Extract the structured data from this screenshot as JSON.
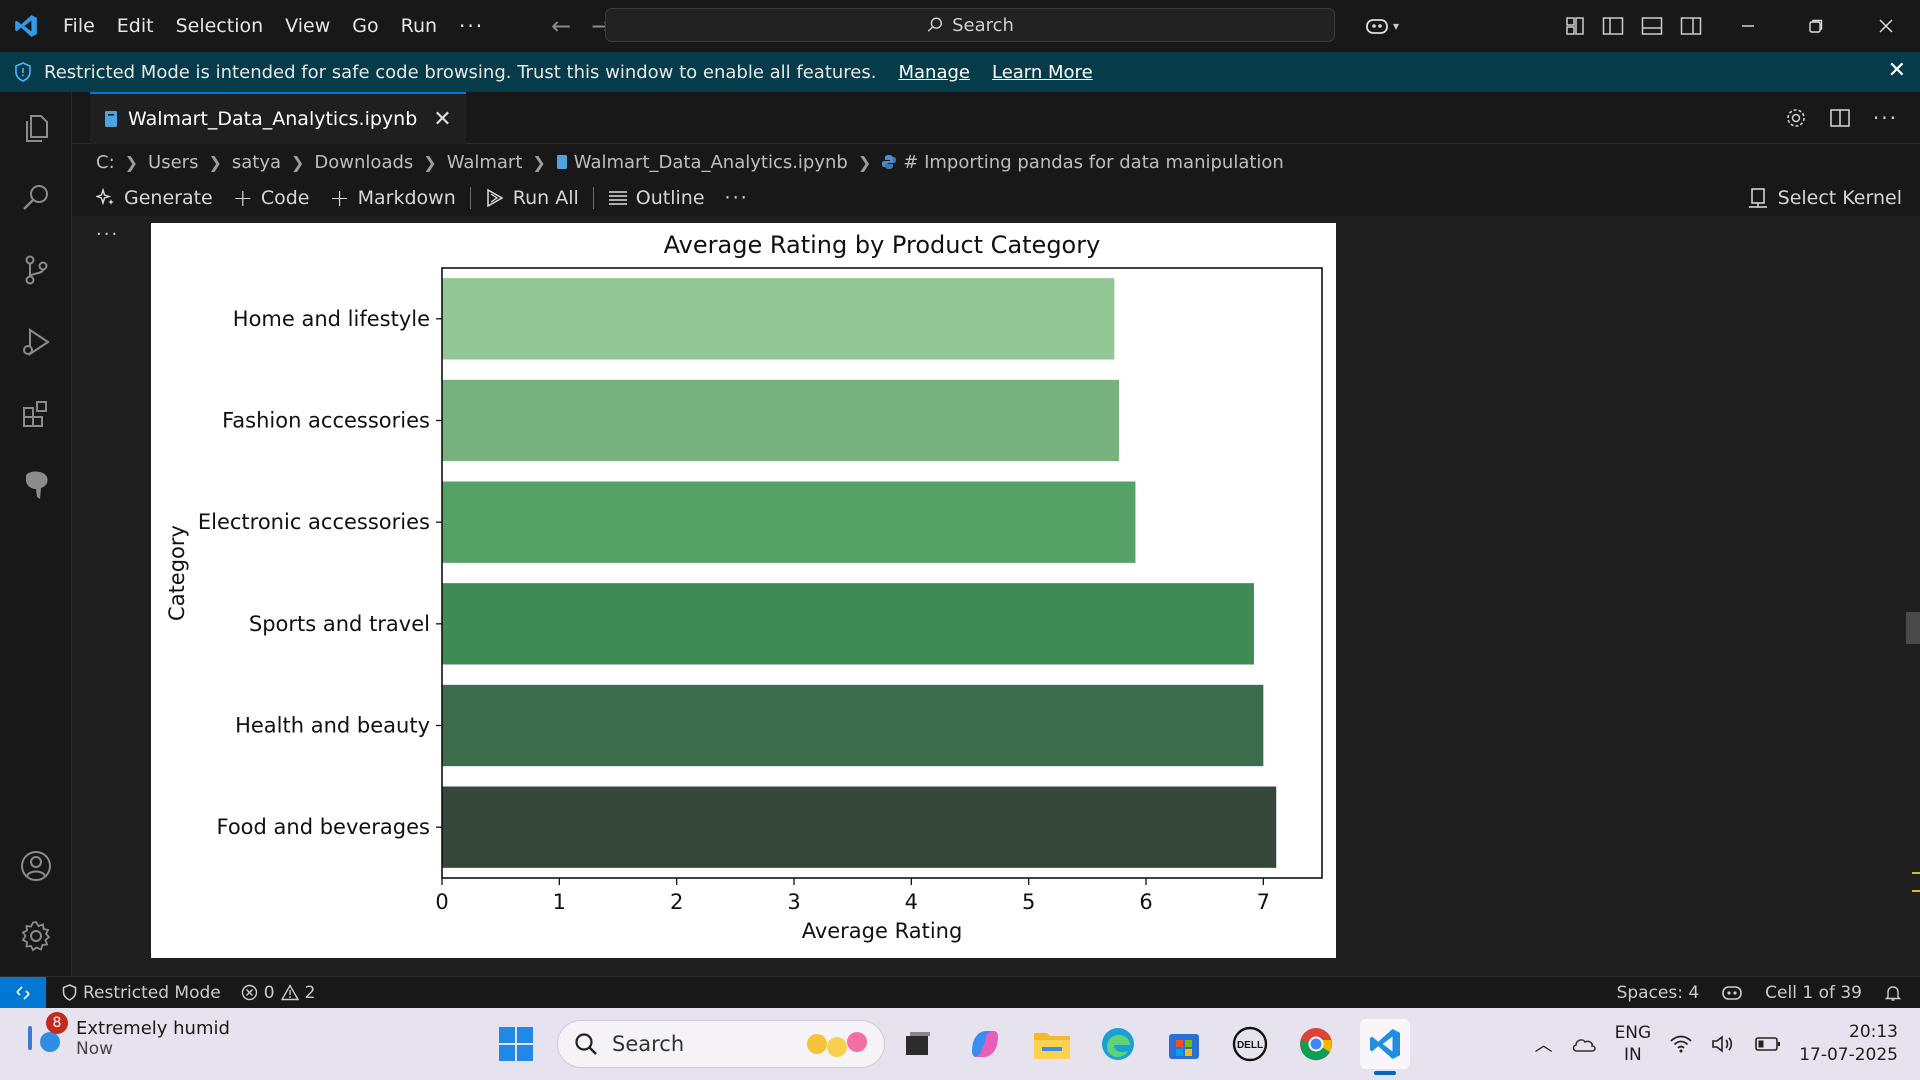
{
  "titlebar": {
    "menus": [
      "File",
      "Edit",
      "Selection",
      "View",
      "Go",
      "Run"
    ],
    "more": "···",
    "search_label": "Search"
  },
  "banner": {
    "message": "Restricted Mode is intended for safe code browsing. Trust this window to enable all features.",
    "manage": "Manage",
    "learn_more": "Learn More"
  },
  "tab": {
    "filename": "Walmart_Data_Analytics.ipynb"
  },
  "breadcrumb": [
    "C:",
    "Users",
    "satya",
    "Downloads",
    "Walmart",
    "Walmart_Data_Analytics.ipynb",
    "# Importing pandas for data manipulation"
  ],
  "nb_toolbar": {
    "generate": "Generate",
    "code": "Code",
    "markdown": "Markdown",
    "run_all": "Run All",
    "outline": "Outline",
    "more": "···",
    "kernel": "Select Kernel"
  },
  "cell_more": "···",
  "chart_data": {
    "type": "bar",
    "orientation": "horizontal",
    "title": "Average Rating by Product Category",
    "xlabel": "Average Rating",
    "ylabel": "Category",
    "categories": [
      "Home and lifestyle",
      "Fashion accessories",
      "Electronic accessories",
      "Sports and travel",
      "Health and beauty",
      "Food and beverages"
    ],
    "values": [
      5.73,
      5.77,
      5.91,
      6.92,
      7.0,
      7.11
    ],
    "colors": [
      "#93c695",
      "#77b27e",
      "#56a166",
      "#3f8a55",
      "#3b6c4b",
      "#35473b"
    ],
    "xticks": [
      0,
      1,
      2,
      3,
      4,
      5,
      6,
      7
    ],
    "xlim": [
      0,
      7.5
    ],
    "grid": false
  },
  "statusbar": {
    "restricted": "Restricted Mode",
    "errors": "0",
    "warnings": "2",
    "spaces": "Spaces: 4",
    "cell": "Cell 1 of 39"
  },
  "taskbar": {
    "weather_title": "Extremely humid",
    "weather_sub": "Now",
    "weather_badge": "8",
    "search": "Search",
    "lang1": "ENG",
    "lang2": "IN",
    "time": "20:13",
    "date": "17-07-2025"
  }
}
